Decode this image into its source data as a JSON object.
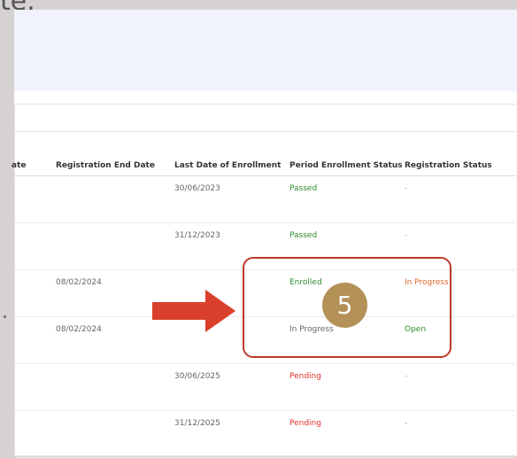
{
  "page": {
    "top_text_fragment": "te.",
    "left_text_fragment": "."
  },
  "table": {
    "headers": [
      "ate",
      "Registration End Date",
      "Last Date of Enrollment",
      "Period Enrollment Status",
      "Registration Status"
    ],
    "rows": [
      [
        "",
        "",
        "30/06/2023",
        "Passed",
        "-"
      ],
      [
        "",
        "",
        "31/12/2023",
        "Passed",
        "-"
      ],
      [
        "",
        "08/02/2024",
        "",
        "Enrolled",
        "In Progress"
      ],
      [
        "",
        "08/02/2024",
        "",
        "In Progress",
        "Open"
      ],
      [
        "",
        "",
        "30/06/2025",
        "Pending",
        "-"
      ],
      [
        "",
        "",
        "31/12/2025",
        "Pending",
        "-"
      ]
    ]
  },
  "annotation": {
    "step_number": "5",
    "box_color": "#c0392b",
    "arrow_color": "#d9402b",
    "badge_color": "#b39157"
  },
  "status_colors": {
    "passed": "#2e8b2e",
    "enrolled": "#2e8b2e",
    "open": "#2e8b2e",
    "pending": "#e0302c",
    "in_progress_registration": "#e06a2a",
    "in_progress_period": "#666666"
  }
}
